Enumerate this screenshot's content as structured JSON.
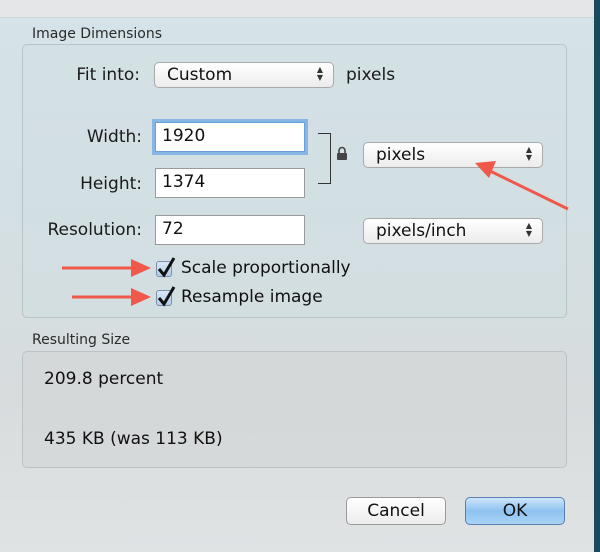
{
  "image_dimensions": {
    "title": "Image Dimensions",
    "fit_into": {
      "label": "Fit into:",
      "value": "Custom",
      "unit": "pixels"
    },
    "width": {
      "label": "Width:",
      "value": "1920"
    },
    "height": {
      "label": "Height:",
      "value": "1374"
    },
    "resolution": {
      "label": "Resolution:",
      "value": "72"
    },
    "size_unit": "pixels",
    "resolution_unit": "pixels/inch",
    "scale_proportionally": {
      "label": "Scale proportionally",
      "checked": true
    },
    "resample_image": {
      "label": "Resample image",
      "checked": true
    }
  },
  "resulting_size": {
    "title": "Resulting Size",
    "percent": "209.8 percent",
    "file_size": "435 KB (was 113 KB)"
  },
  "buttons": {
    "cancel": "Cancel",
    "ok": "OK"
  },
  "annotation_color": "#f0584a"
}
